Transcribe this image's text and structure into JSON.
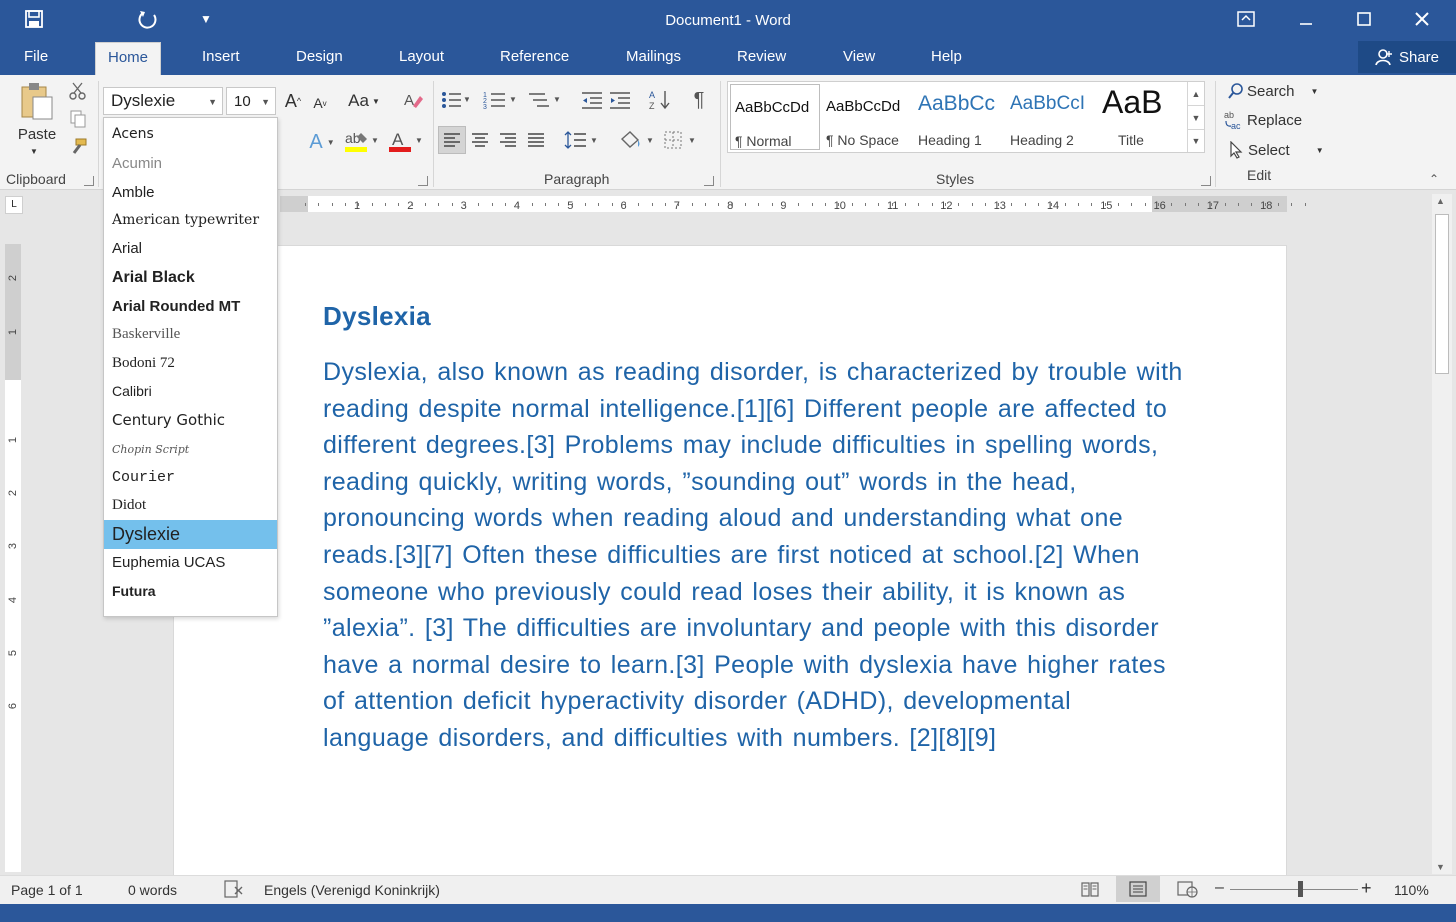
{
  "titlebar": {
    "title": "Document1 - Word",
    "save_icon": "save-icon",
    "undo_icon": "undo-icon",
    "customize_icon": "customize-quick-access-icon"
  },
  "tabs": [
    {
      "label": "File"
    },
    {
      "label": "Home",
      "active": true
    },
    {
      "label": "Insert"
    },
    {
      "label": "Design"
    },
    {
      "label": "Layout"
    },
    {
      "label": "Reference"
    },
    {
      "label": "Mailings"
    },
    {
      "label": "Review"
    },
    {
      "label": "View"
    },
    {
      "label": "Help"
    }
  ],
  "share_label": "Share",
  "ribbon": {
    "clipboard": {
      "paste_label": "Paste",
      "group_label": "Clipboard"
    },
    "font": {
      "font_name": "Dyslexie",
      "font_size": "10",
      "case_label": "Aa"
    },
    "paragraph": {
      "group_label": "Paragraph"
    },
    "styles": {
      "group_label": "Styles",
      "items": [
        {
          "preview": "AaBbCcDd",
          "name": "¶ Normal"
        },
        {
          "preview": "AaBbCcDd",
          "name": "¶ No Space"
        },
        {
          "preview": "AaBbCc",
          "name": "Heading 1"
        },
        {
          "preview": "AaBbCcI",
          "name": "Heading 2"
        },
        {
          "preview": "AaB",
          "name": "Title"
        }
      ]
    },
    "editing": {
      "search_label": "Search",
      "replace_label": "Replace",
      "select_label": "Select",
      "group_label": "Edit"
    }
  },
  "font_list": [
    {
      "name": "Acens"
    },
    {
      "name": "Acumin"
    },
    {
      "name": "Amble"
    },
    {
      "name": "American typewriter"
    },
    {
      "name": "Arial"
    },
    {
      "name": "Arial Black"
    },
    {
      "name": "Arial Rounded MT"
    },
    {
      "name": "Baskerville"
    },
    {
      "name": "Bodoni 72"
    },
    {
      "name": "Calibri"
    },
    {
      "name": "Century Gothic"
    },
    {
      "name": "Chopin Script"
    },
    {
      "name": "Courier"
    },
    {
      "name": "Didot"
    },
    {
      "name": "Dyslexie",
      "selected": true
    },
    {
      "name": "Euphemia UCAS"
    },
    {
      "name": "Futura"
    }
  ],
  "ruler": {
    "h_ticks": [
      "1",
      "2",
      "3",
      "4",
      "5",
      "6",
      "7",
      "8",
      "9",
      "10",
      "11",
      "12",
      "13",
      "14",
      "15",
      "16",
      "17",
      "18"
    ],
    "v_ticks": [
      "2",
      "1",
      "1",
      "2",
      "3",
      "4",
      "5",
      "6"
    ]
  },
  "document": {
    "heading": "Dyslexia",
    "body": "Dyslexia, also known as reading disorder, is characterized by trouble with reading despite normal intelligence.[1][6] Different people are affected to different degrees.[3] Problems may include difficulties in spelling words, reading quickly, writing words, ”sounding out” words in the head, pronouncing words when reading aloud and understanding what one reads.[3][7] Often these difficulties are first noticed at school.[2] When someone who previously could read loses their ability, it is known as ”alexia”. [3] The difficulties are involuntary and people with this disorder have a normal desire to learn.[3] People with dyslexia have higher rates of attention deficit hyperactivity disorder (ADHD), developmental language disorders, and difficulties with numbers. [2][8][9]"
  },
  "statusbar": {
    "page": "Page 1 of 1",
    "words": "0 words",
    "language": "Engels (Verenigd Koninkrijk)",
    "zoom": "110%",
    "zoom_level": 0.55
  },
  "colors": {
    "brand": "#2b579a",
    "document_text": "#1f64a8",
    "selection": "#74c0ec"
  }
}
